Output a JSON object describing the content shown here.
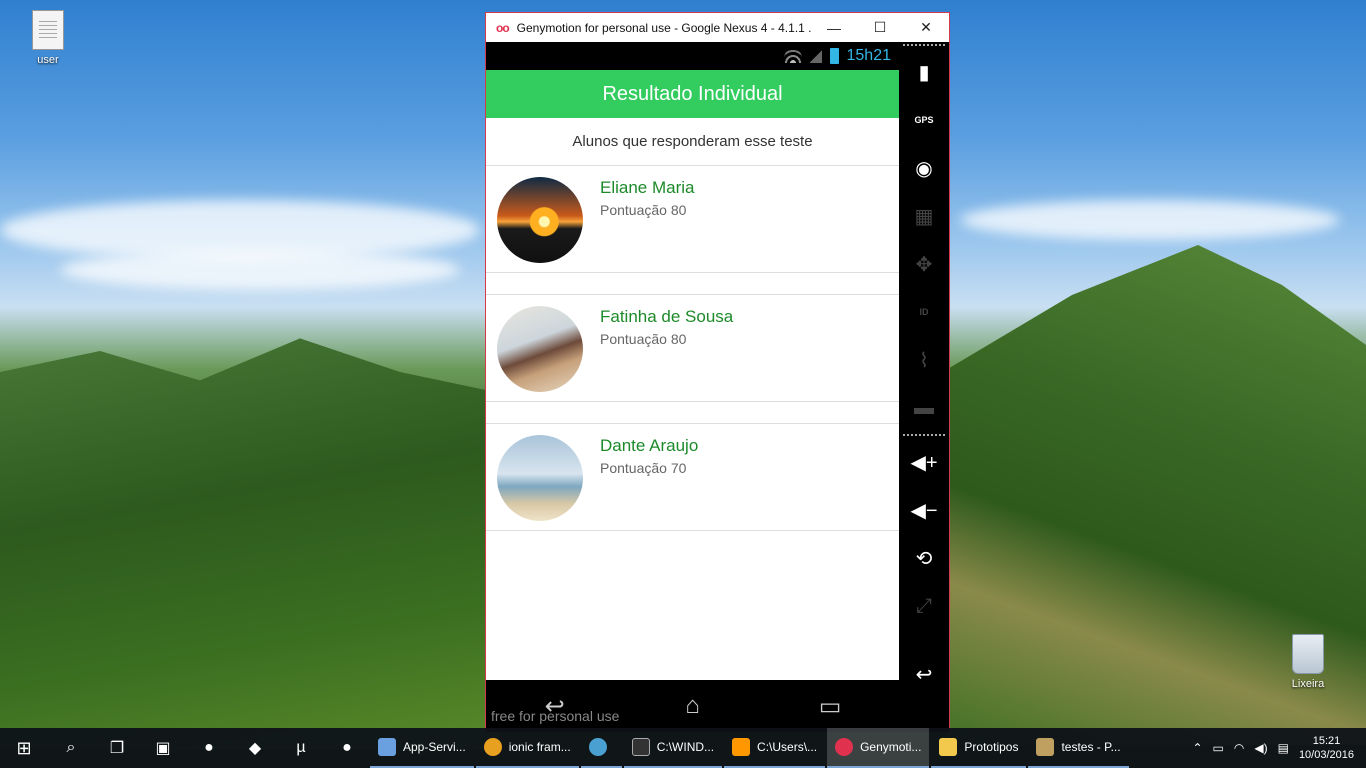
{
  "desktop": {
    "icons": [
      {
        "label": "user"
      },
      {
        "label": "Lixeira"
      }
    ]
  },
  "window": {
    "logo": "oo",
    "title": "Genymotion for personal use - Google Nexus 4 - 4.1.1 ...",
    "minimize": "—",
    "maximize": "☐",
    "close": "✕"
  },
  "device": {
    "status_time": "15h21",
    "app_title": "Resultado Individual",
    "subtitle": "Alunos que responderam esse teste",
    "students": [
      {
        "name": "Eliane Maria",
        "score": "Pontuação 80"
      },
      {
        "name": "Fatinha de Sousa",
        "score": "Pontuação 80"
      },
      {
        "name": "Dante Araujo",
        "score": "Pontuação 70"
      }
    ],
    "watermark": "free for personal use"
  },
  "sidebar": {
    "gps_label": "GPS",
    "id_label": "ID"
  },
  "taskbar": {
    "apps": [
      {
        "label": "App-Servi...",
        "color": "#6aa0e0"
      },
      {
        "label": "ionic fram...",
        "color": "#e8a020"
      },
      {
        "label": "",
        "color": "#4aa0d0"
      },
      {
        "label": "C:\\WIND...",
        "color": "#333333"
      },
      {
        "label": "C:\\Users\\...",
        "color": "#ff9800"
      },
      {
        "label": "Genymoti...",
        "color": "#e0324e"
      },
      {
        "label": "Prototipos",
        "color": "#f2c94c"
      },
      {
        "label": "testes - P...",
        "color": "#c0a060"
      }
    ],
    "clock_time": "15:21",
    "clock_date": "10/03/2016"
  }
}
